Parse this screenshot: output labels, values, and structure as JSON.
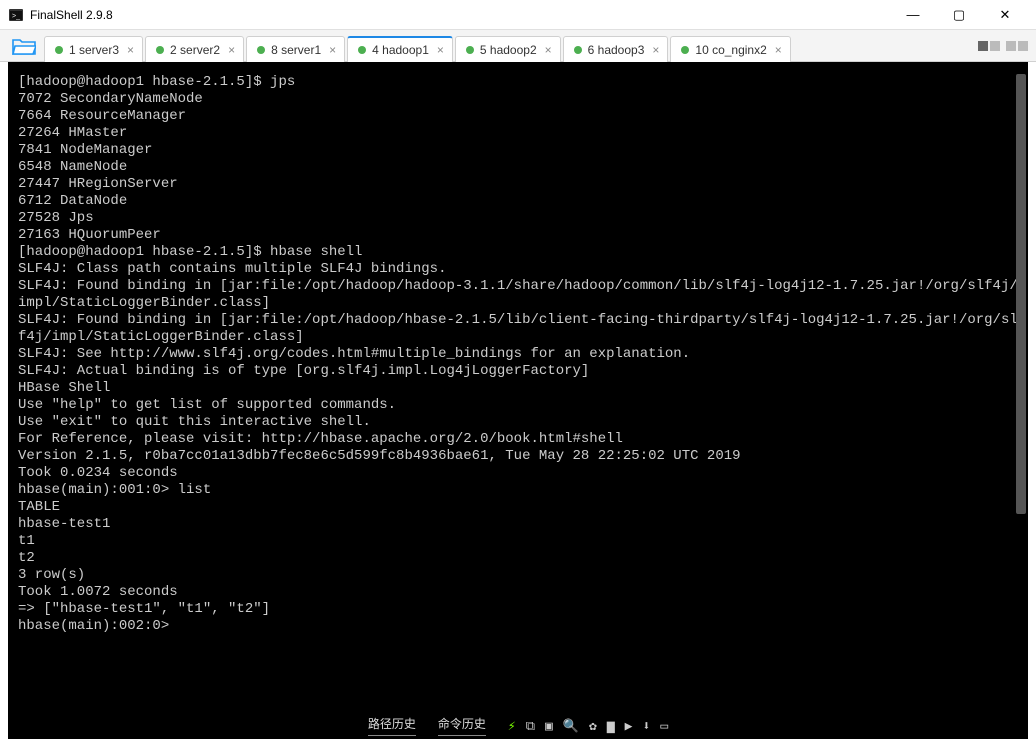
{
  "window": {
    "title": "FinalShell 2.9.8"
  },
  "tabs": [
    {
      "dot": "#4caf50",
      "label": "1 server3",
      "active": false
    },
    {
      "dot": "#4caf50",
      "label": "2 server2",
      "active": false
    },
    {
      "dot": "#4caf50",
      "label": "8 server1",
      "active": false
    },
    {
      "dot": "#4caf50",
      "label": "4 hadoop1",
      "active": true
    },
    {
      "dot": "#4caf50",
      "label": "5 hadoop2",
      "active": false
    },
    {
      "dot": "#4caf50",
      "label": "6 hadoop3",
      "active": false
    },
    {
      "dot": "#4caf50",
      "label": "10 co_nginx2",
      "active": false
    }
  ],
  "terminal_lines": [
    "[hadoop@hadoop1 hbase-2.1.5]$ jps",
    "7072 SecondaryNameNode",
    "7664 ResourceManager",
    "27264 HMaster",
    "7841 NodeManager",
    "6548 NameNode",
    "27447 HRegionServer",
    "6712 DataNode",
    "27528 Jps",
    "27163 HQuorumPeer",
    "[hadoop@hadoop1 hbase-2.1.5]$ hbase shell",
    "SLF4J: Class path contains multiple SLF4J bindings.",
    "SLF4J: Found binding in [jar:file:/opt/hadoop/hadoop-3.1.1/share/hadoop/common/lib/slf4j-log4j12-1.7.25.jar!/org/slf4j/impl/StaticLoggerBinder.class]",
    "SLF4J: Found binding in [jar:file:/opt/hadoop/hbase-2.1.5/lib/client-facing-thirdparty/slf4j-log4j12-1.7.25.jar!/org/slf4j/impl/StaticLoggerBinder.class]",
    "SLF4J: See http://www.slf4j.org/codes.html#multiple_bindings for an explanation.",
    "SLF4J: Actual binding is of type [org.slf4j.impl.Log4jLoggerFactory]",
    "HBase Shell",
    "Use \"help\" to get list of supported commands.",
    "Use \"exit\" to quit this interactive shell.",
    "For Reference, please visit: http://hbase.apache.org/2.0/book.html#shell",
    "Version 2.1.5, r0ba7cc01a13dbb7fec8e6c5d599fc8b4936bae61, Tue May 28 22:25:02 UTC 2019",
    "Took 0.0234 seconds",
    "hbase(main):001:0> list",
    "TABLE",
    "hbase-test1",
    "t1",
    "t2",
    "3 row(s)",
    "Took 1.0072 seconds",
    "=> [\"hbase-test1\", \"t1\", \"t2\"]",
    "hbase(main):002:0> "
  ],
  "bottom": {
    "path_history": "路径历史",
    "cmd_history": "命令历史"
  }
}
